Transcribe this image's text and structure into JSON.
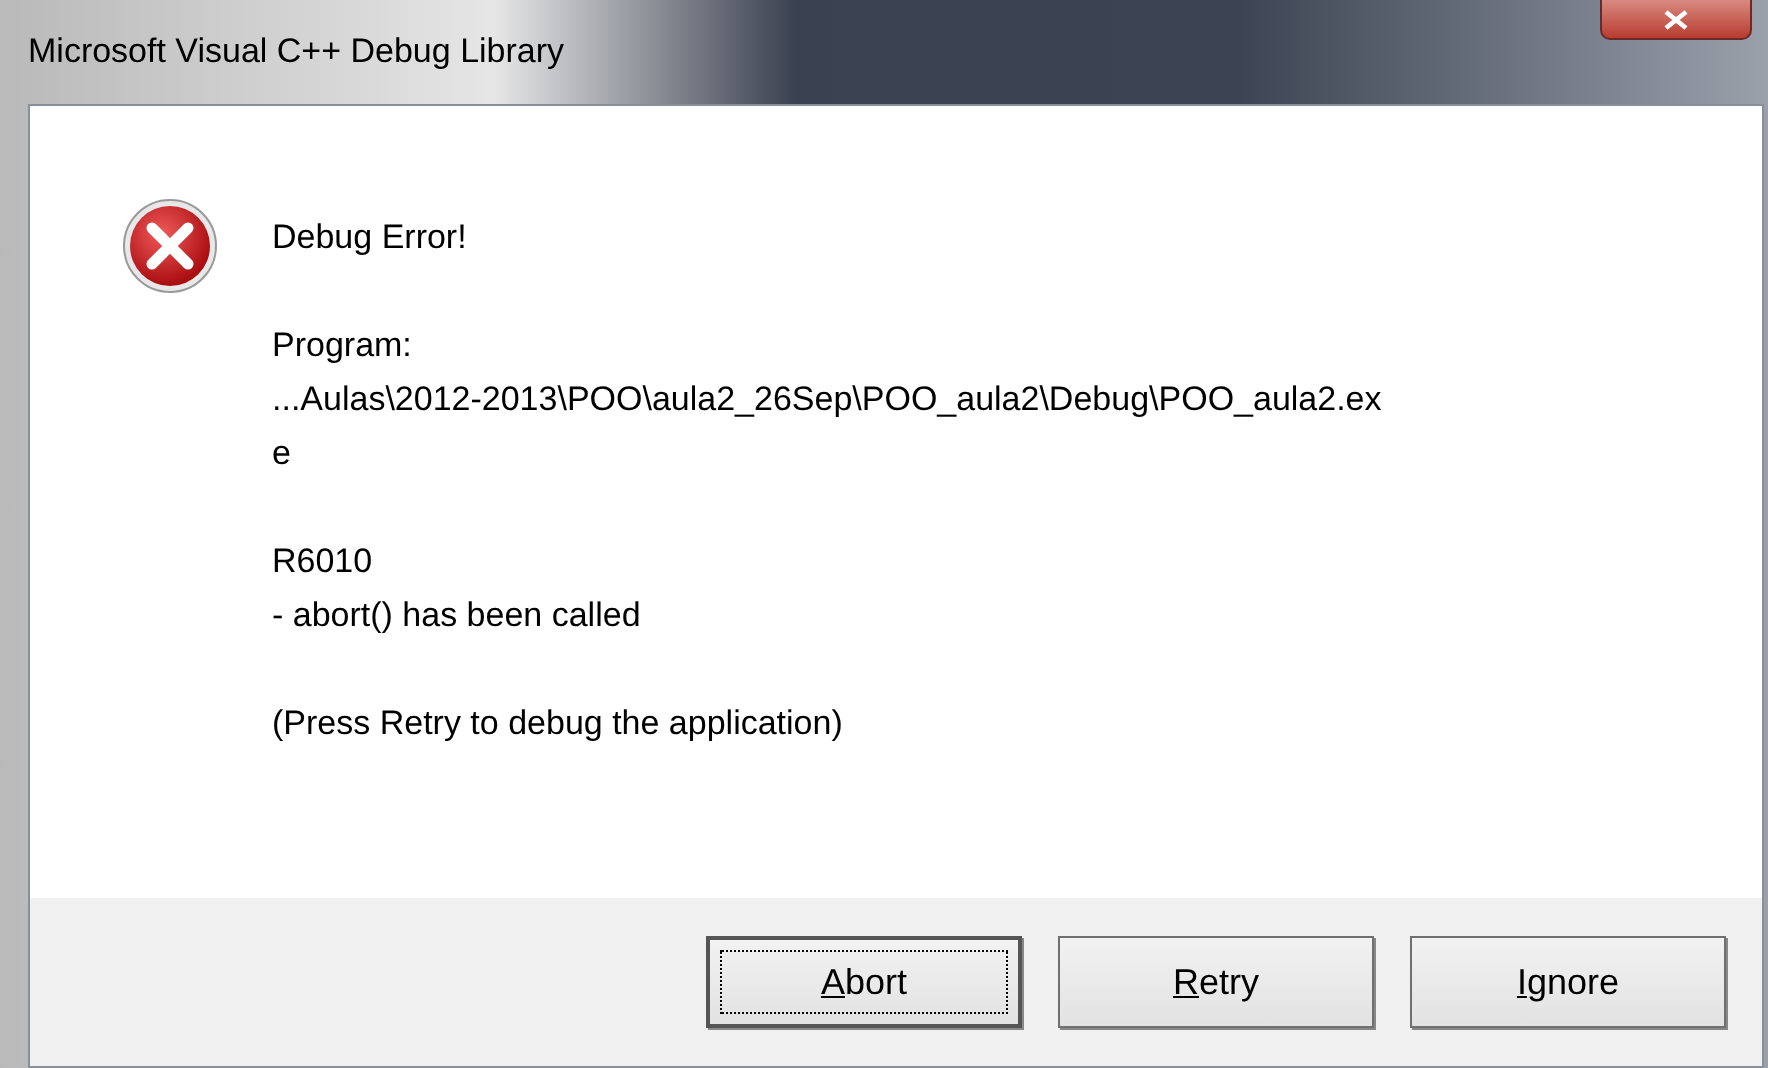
{
  "window": {
    "title": "Microsoft Visual C++ Debug Library"
  },
  "message": [
    {
      "lines": [
        "Debug Error!"
      ]
    },
    {
      "lines": [
        "Program:",
        "...Aulas\\2012-2013\\POO\\aula2_26Sep\\POO_aula2\\Debug\\POO_aula2.ex",
        "e"
      ]
    },
    {
      "lines": [
        "R6010",
        "- abort() has been called"
      ]
    },
    {
      "lines": [
        "(Press Retry to debug the application)"
      ]
    }
  ],
  "buttons": [
    {
      "label": "Abort",
      "focused": true
    },
    {
      "label": "Retry",
      "focused": false
    },
    {
      "label": "Ignore",
      "focused": false
    }
  ]
}
